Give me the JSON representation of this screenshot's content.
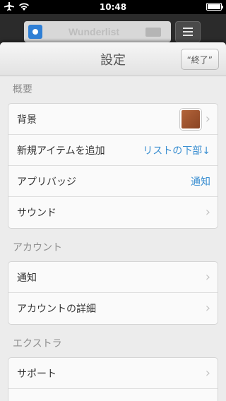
{
  "status": {
    "time": "10:48"
  },
  "background_app": {
    "title": "Wunderlist"
  },
  "nav": {
    "title": "設定",
    "done_label": "“終了”"
  },
  "sections": [
    {
      "header": "概要",
      "rows": [
        {
          "label": "背景",
          "value": "",
          "swatch_color": "#a0552e"
        },
        {
          "label": "新規アイテムを追加",
          "value": "リストの下部↓"
        },
        {
          "label": "アプリバッジ",
          "value": "通知"
        },
        {
          "label": "サウンド",
          "value": ""
        }
      ]
    },
    {
      "header": "アカウント",
      "rows": [
        {
          "label": "通知",
          "value": ""
        },
        {
          "label": "アカウントの詳細",
          "value": ""
        }
      ]
    },
    {
      "header": "エクストラ",
      "rows": [
        {
          "label": "サポート",
          "value": ""
        }
      ]
    }
  ],
  "colors": {
    "accent": "#3b8fd1",
    "sheet": "#ececec"
  }
}
